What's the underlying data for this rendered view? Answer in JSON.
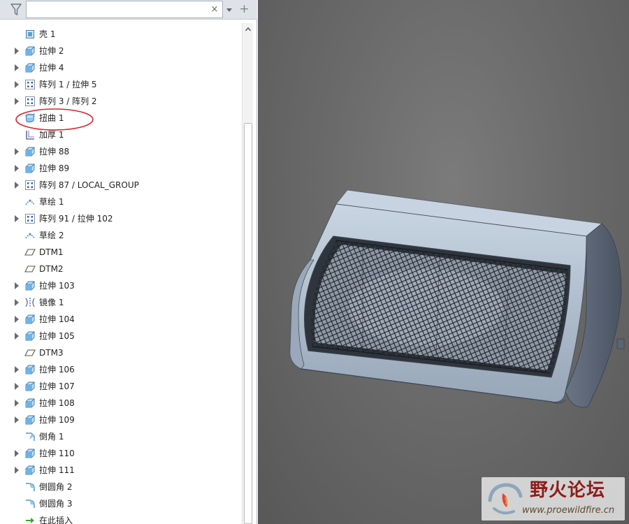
{
  "search": {
    "value": "",
    "placeholder": ""
  },
  "toolbar": {
    "clear_glyph": "×",
    "add_glyph": "+"
  },
  "tree": {
    "items": [
      {
        "label": "壳 1",
        "icon": "shell-icon",
        "expandable": false
      },
      {
        "label": "拉伸 2",
        "icon": "extrude-icon",
        "expandable": true
      },
      {
        "label": "拉伸 4",
        "icon": "extrude-icon",
        "expandable": true
      },
      {
        "label": "阵列 1 / 拉伸 5",
        "icon": "pattern-icon",
        "expandable": true
      },
      {
        "label": "阵列 3 / 阵列 2",
        "icon": "pattern-icon",
        "expandable": true
      },
      {
        "label": "扭曲 1",
        "icon": "warp-icon",
        "expandable": false,
        "highlighted": true
      },
      {
        "label": "加厚 1",
        "icon": "thicken-icon",
        "expandable": false
      },
      {
        "label": "拉伸 88",
        "icon": "extrude-icon",
        "expandable": true
      },
      {
        "label": "拉伸 89",
        "icon": "extrude-icon",
        "expandable": true
      },
      {
        "label": "阵列 87 / LOCAL_GROUP",
        "icon": "pattern-icon",
        "expandable": true
      },
      {
        "label": "草绘 1",
        "icon": "sketch-icon",
        "expandable": false
      },
      {
        "label": "阵列 91 / 拉伸 102",
        "icon": "pattern-icon",
        "expandable": true
      },
      {
        "label": "草绘 2",
        "icon": "sketch-icon",
        "expandable": false
      },
      {
        "label": "DTM1",
        "icon": "datum-plane-icon",
        "expandable": false
      },
      {
        "label": "DTM2",
        "icon": "datum-plane-icon",
        "expandable": false
      },
      {
        "label": "拉伸 103",
        "icon": "extrude-icon",
        "expandable": true
      },
      {
        "label": "镜像 1",
        "icon": "mirror-icon",
        "expandable": true
      },
      {
        "label": "拉伸 104",
        "icon": "extrude-icon",
        "expandable": true
      },
      {
        "label": "拉伸 105",
        "icon": "extrude-icon",
        "expandable": true
      },
      {
        "label": "DTM3",
        "icon": "datum-plane-icon",
        "expandable": false
      },
      {
        "label": "拉伸 106",
        "icon": "extrude-icon",
        "expandable": true
      },
      {
        "label": "拉伸 107",
        "icon": "extrude-icon",
        "expandable": true
      },
      {
        "label": "拉伸 108",
        "icon": "extrude-icon",
        "expandable": true
      },
      {
        "label": "拉伸 109",
        "icon": "extrude-icon",
        "expandable": true
      },
      {
        "label": "倒角 1",
        "icon": "chamfer-icon",
        "expandable": false
      },
      {
        "label": "拉伸 110",
        "icon": "extrude-icon",
        "expandable": true
      },
      {
        "label": "拉伸 111",
        "icon": "extrude-icon",
        "expandable": true
      },
      {
        "label": "倒圆角 2",
        "icon": "round-icon",
        "expandable": false
      },
      {
        "label": "倒圆角 3",
        "icon": "round-icon",
        "expandable": false
      },
      {
        "label": "在此插入",
        "icon": "insert-here-icon",
        "expandable": false
      }
    ]
  },
  "annotation": {
    "color": "#d6262a"
  },
  "watermark": {
    "name": "野火论坛",
    "url": "www.proewildfire.cn"
  },
  "colors": {
    "viewport": "#6a6a6a",
    "model_body": "#b8c6d6",
    "model_dark": "#4c5666",
    "accent_red": "#d6262a"
  }
}
